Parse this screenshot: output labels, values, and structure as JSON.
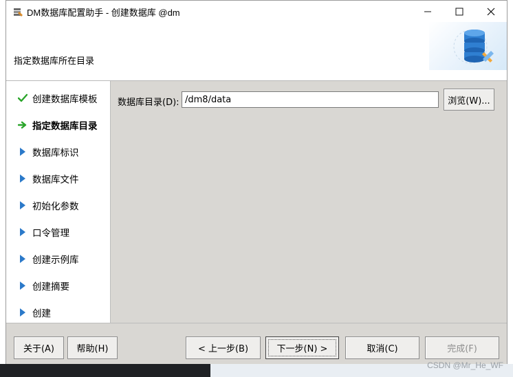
{
  "window": {
    "title": "DM数据库配置助手 - 创建数据库 @dm",
    "controls": {
      "minimize": "—",
      "maximize": "☐",
      "close": "✕"
    }
  },
  "header": {
    "label": "指定数据库所在目录"
  },
  "nav": {
    "items": [
      {
        "label": "创建数据库模板",
        "state": "done"
      },
      {
        "label": "指定数据库目录",
        "state": "active"
      },
      {
        "label": "数据库标识",
        "state": "pending"
      },
      {
        "label": "数据库文件",
        "state": "pending"
      },
      {
        "label": "初始化参数",
        "state": "pending"
      },
      {
        "label": "口令管理",
        "state": "pending"
      },
      {
        "label": "创建示例库",
        "state": "pending"
      },
      {
        "label": "创建摘要",
        "state": "pending"
      },
      {
        "label": "创建",
        "state": "pending"
      }
    ]
  },
  "form": {
    "dir_label": "数据库目录(D):",
    "dir_value": "/dm8/data",
    "browse_label": "浏览(W)..."
  },
  "footer": {
    "about": "关于(A)",
    "help": "帮助(H)",
    "prev": "< 上一步(B)",
    "next": "下一步(N) >",
    "cancel": "取消(C)",
    "finish": "完成(F)"
  },
  "watermark": "CSDN @Mr_He_WF",
  "colors": {
    "check": "#2aa52a",
    "arrow_active": "#2aa52a",
    "arrow_pending": "#2b79c9"
  }
}
